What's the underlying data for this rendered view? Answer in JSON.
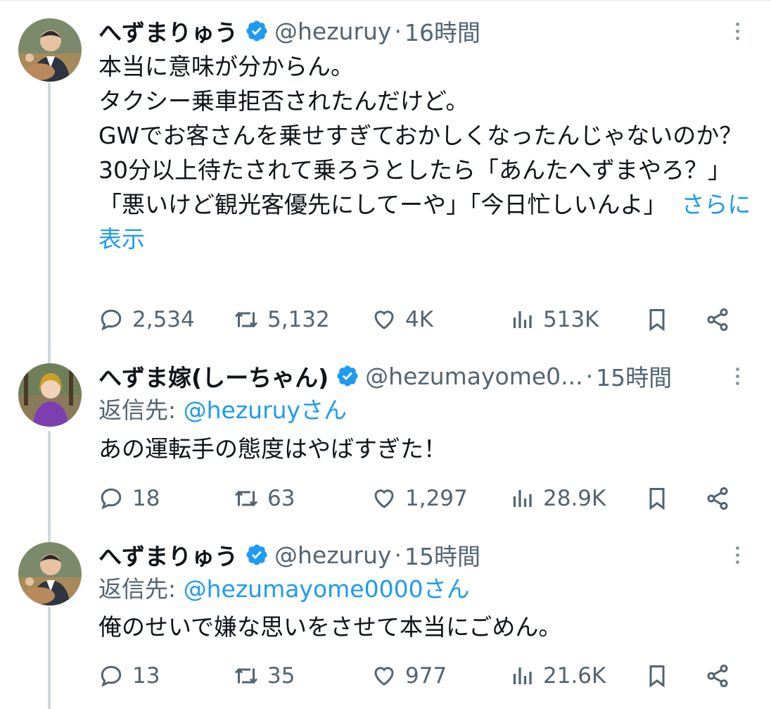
{
  "tweets": [
    {
      "name": "へずまりゅう",
      "handle": "@hezuruy",
      "time": "16時間",
      "text": "本当に意味が分からん。\nタクシー乗車拒否されたんだけど。\nGWでお客さんを乗せすぎておかしくなったんじゃないのか？\n30分以上待たされて乗ろうとしたら「あんたへずまやろ？」「悪いけど観光客優先にしてーや」「今日忙しいんよ」",
      "show_more": "さらに表示",
      "replies": "2,534",
      "retweets": "5,132",
      "likes": "4K",
      "views": "513K"
    },
    {
      "name": "へずま嫁(しーちゃん)",
      "handle": "@hezumayome0...",
      "time": "15時間",
      "reply_label": "返信先: ",
      "reply_handle": "@hezuruyさん",
      "text": "あの運転手の態度はやばすぎた！",
      "replies": "18",
      "retweets": "63",
      "likes": "1,297",
      "views": "28.9K"
    },
    {
      "name": "へずまりゅう",
      "handle": "@hezuruy",
      "time": "15時間",
      "reply_label": "返信先: ",
      "reply_handle": "@hezumayome0000さん",
      "text": "俺のせいで嫌な思いをさせて本当にごめん。",
      "replies": "13",
      "retweets": "35",
      "likes": "977",
      "views": "21.6K"
    }
  ],
  "separator": "·",
  "colors": {
    "text": "#0f1419",
    "secondary": "#536471",
    "link": "#1d9bf0",
    "verified": "#1d9bf0",
    "thread_line": "#cfd9de"
  },
  "icons": {
    "reply": "speech-bubble-icon",
    "retweet": "retweet-icon",
    "like": "heart-icon",
    "views": "bar-chart-icon",
    "bookmark": "bookmark-icon",
    "share": "share-icon",
    "verified": "verified-badge-icon",
    "more": "more-vertical-icon"
  }
}
